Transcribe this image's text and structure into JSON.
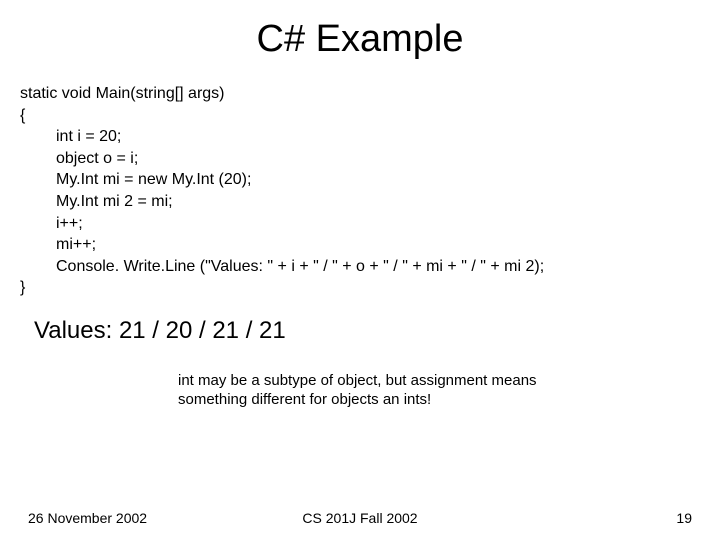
{
  "title": "C# Example",
  "code": {
    "l0": "static void Main(string[] args)",
    "l1": "{",
    "l2": "int i = 20;",
    "l3": "object o = i;",
    "l4": "My.Int mi = new My.Int (20);",
    "l5": "My.Int mi 2 = mi;",
    "l6": "i++;",
    "l7": "mi++;",
    "l8": "Console. Write.Line (\"Values: \" + i + \" / \" + o + \" / \" + mi + \" / \" + mi 2);",
    "l9": "}"
  },
  "output": "Values: 21 / 20 / 21 / 21",
  "note": "int may be a subtype of object, but assignment means something different for objects an ints!",
  "footer": {
    "date": "26 November 2002",
    "course": "CS 201J Fall 2002",
    "page": "19"
  }
}
